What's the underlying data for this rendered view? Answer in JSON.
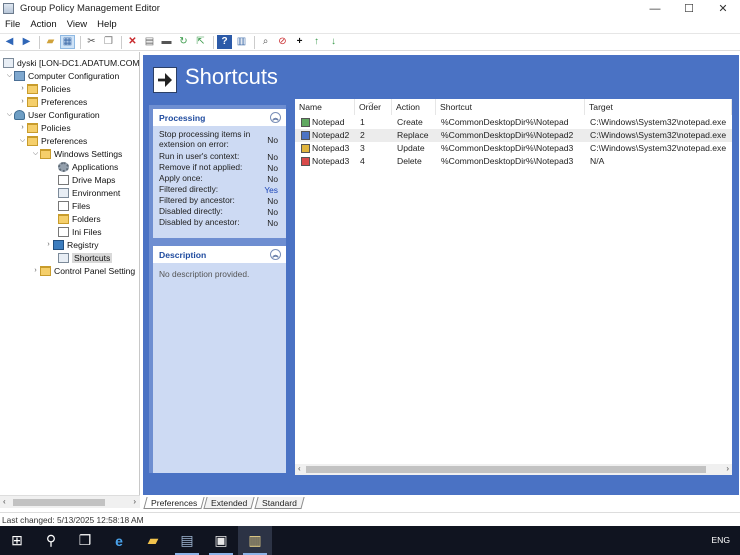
{
  "window": {
    "title": "Group Policy Management Editor",
    "controls": {
      "minimize": "—",
      "maximize": "☐",
      "close": "✕"
    }
  },
  "menubar": [
    "File",
    "Action",
    "View",
    "Help"
  ],
  "toolbar": {
    "icons": [
      "back-arrow-icon",
      "forward-arrow-icon",
      "up-folder-icon",
      "show-hide-tree-icon",
      "cut-icon",
      "copy-icon",
      "delete-icon",
      "properties-icon",
      "print-icon",
      "refresh-icon",
      "export-list-icon",
      "help-icon",
      "show-action-pane-icon",
      "filter-icon",
      "stop-icon",
      "add-icon",
      "move-up-icon",
      "move-down-icon"
    ]
  },
  "tree": {
    "root": "dyski [LON-DC1.ADATUM.COM",
    "computer_configuration": "Computer Configuration",
    "cc_policies": "Policies",
    "cc_preferences": "Preferences",
    "user_configuration": "User Configuration",
    "uc_policies": "Policies",
    "uc_preferences": "Preferences",
    "windows_settings": "Windows Settings",
    "applications": "Applications",
    "drive_maps": "Drive Maps",
    "environment": "Environment",
    "files": "Files",
    "folders": "Folders",
    "ini_files": "Ini Files",
    "registry": "Registry",
    "shortcuts": "Shortcuts",
    "control_panel_settings": "Control Panel Setting"
  },
  "header": {
    "title": "Shortcuts"
  },
  "processing": {
    "title": "Processing",
    "rows": [
      {
        "label": "Stop processing items in extension on error:",
        "value": "No"
      },
      {
        "label": "Run in user's context:",
        "value": "No"
      },
      {
        "label": "Remove if not applied:",
        "value": "No"
      },
      {
        "label": "Apply once:",
        "value": "No"
      },
      {
        "label": "Filtered directly:",
        "value": "Yes"
      },
      {
        "label": "Filtered by ancestor:",
        "value": "No"
      },
      {
        "label": "Disabled directly:",
        "value": "No"
      },
      {
        "label": "Disabled by ancestor:",
        "value": "No"
      }
    ]
  },
  "description": {
    "title": "Description",
    "text": "No description provided."
  },
  "grid": {
    "columns": [
      "Name",
      "Order",
      "Action",
      "Shortcut",
      "Target"
    ],
    "rows": [
      {
        "name": "Notepad",
        "order": "1",
        "action": "Create",
        "shortcut": "%CommonDesktopDir%\\Notepad",
        "target": "C:\\Windows\\System32\\notepad.exe",
        "icon": "create-icon"
      },
      {
        "name": "Notepad2",
        "order": "2",
        "action": "Replace",
        "shortcut": "%CommonDesktopDir%\\Notepad2",
        "target": "C:\\Windows\\System32\\notepad.exe",
        "icon": "replace-icon"
      },
      {
        "name": "Notepad3",
        "order": "3",
        "action": "Update",
        "shortcut": "%CommonDesktopDir%\\Notepad3",
        "target": "C:\\Windows\\System32\\notepad.exe",
        "icon": "update-icon"
      },
      {
        "name": "Notepad3",
        "order": "4",
        "action": "Delete",
        "shortcut": "%CommonDesktopDir%\\Notepad3",
        "target": "N/A",
        "icon": "delete-icon"
      }
    ]
  },
  "tabs": [
    "Preferences",
    "Extended",
    "Standard"
  ],
  "status": {
    "text": "Last changed: 5/13/2025 12:58:18 AM"
  },
  "taskbar": {
    "items": [
      "start-icon",
      "search-icon",
      "task-view-icon",
      "internet-explorer-icon",
      "file-explorer-icon",
      "server-manager-icon",
      "group-policy-management-icon",
      "group-policy-editor-icon"
    ],
    "language": "ENG"
  }
}
